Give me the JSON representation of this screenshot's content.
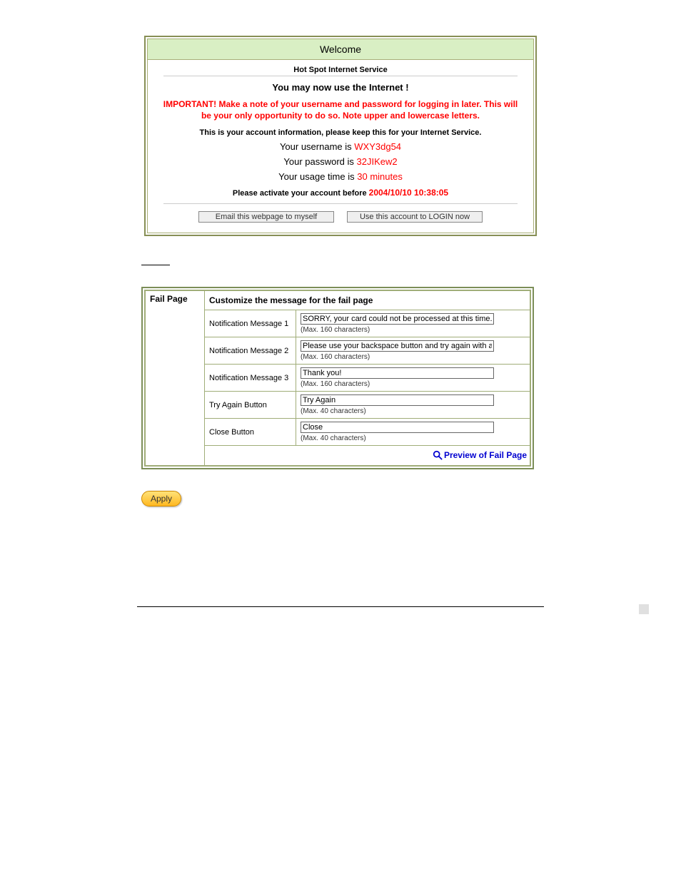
{
  "welcome": {
    "title": "Welcome",
    "service": "Hot Spot Internet Service",
    "use_internet": "You may now use the Internet !",
    "important": "IMPORTANT! Make a note of your username and password for logging in later. This will be your only opportunity to do so. Note upper and lowercase letters.",
    "account_note": "This is your account information, please keep this for your Internet Service.",
    "username_label": "Your username is",
    "username_value": "WXY3dg54",
    "password_label": "Your password is",
    "password_value": "32JIKew2",
    "usage_label": "Your usage time is",
    "usage_value": "30 minutes",
    "activate_label": "Please activate your account before",
    "activate_value": "2004/10/10 10:38:05",
    "email_button": "Email this webpage to myself",
    "login_button": "Use this account to LOGIN now"
  },
  "fail": {
    "side_label": "Fail Page",
    "section_title": "Customize the message for the fail page",
    "rows": {
      "msg1": {
        "label": "Notification Message 1",
        "value": "SORRY, your card could not be processed at this time.",
        "hint": "(Max. 160 characters)"
      },
      "msg2": {
        "label": "Notification Message 2",
        "value": "Please use your backspace button and try again with a different credi",
        "hint": "(Max. 160 characters)"
      },
      "msg3": {
        "label": "Notification Message 3",
        "value": "Thank you!",
        "hint": "(Max. 160 characters)"
      },
      "try": {
        "label": "Try Again Button",
        "value": "Try Again",
        "hint": "(Max. 40 characters)"
      },
      "close": {
        "label": "Close Button",
        "value": "Close",
        "hint": "(Max. 40 characters)"
      }
    },
    "preview_label": "Preview of Fail Page"
  },
  "apply_label": "Apply"
}
